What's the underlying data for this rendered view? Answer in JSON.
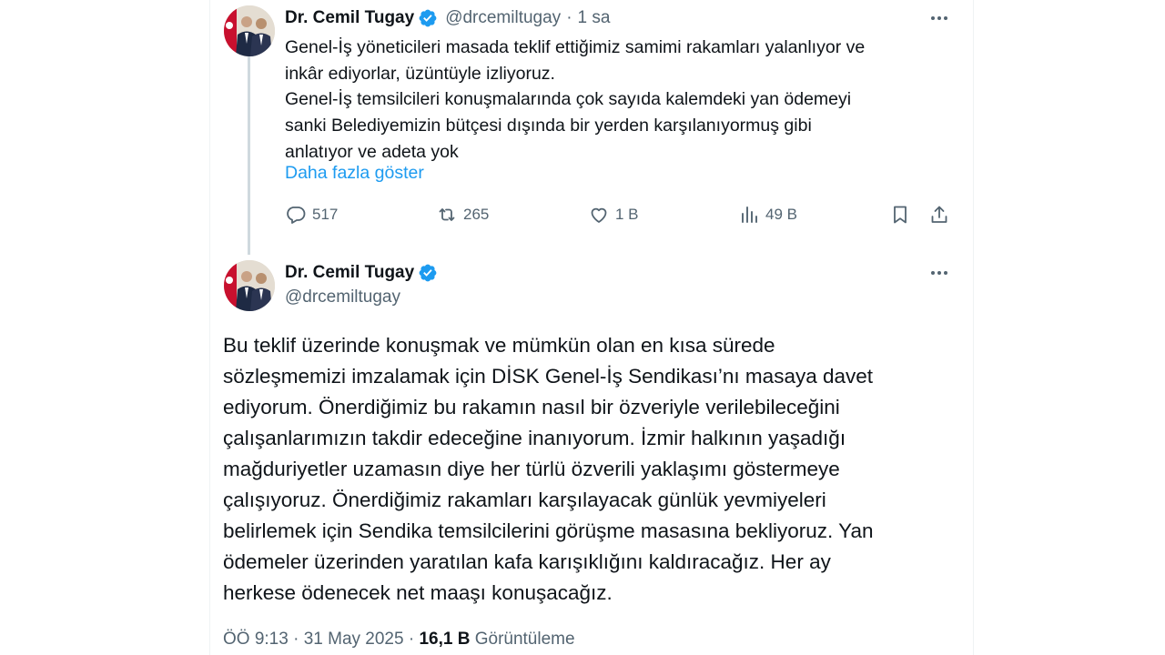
{
  "colors": {
    "accent": "#1d9bf0",
    "text": "#0f1419",
    "muted": "#536471",
    "thread_line": "#cfd9de"
  },
  "reply_tweet": {
    "author_name": "Dr. Cemil Tugay",
    "handle": "@drcemiltugay",
    "separator": "·",
    "time": "1 sa",
    "body_lines": [
      "Genel-İş yöneticileri masada teklif ettiğimiz samimi rakamları yalanlıyor ve",
      "inkâr ediyorlar, üzüntüyle izliyoruz.",
      "Genel-İş temsilcileri konuşmalarında çok sayıda kalemdeki yan ödemeyi",
      "sanki Belediyemizin bütçesi dışında bir yerden karşılanıyormuş gibi",
      "anlatıyor ve adeta yok"
    ],
    "show_more": "Daha fazla göster",
    "replies": "517",
    "reposts": "265",
    "likes": "1 B",
    "views": "49 B",
    "icons": [
      "reply-icon",
      "repost-icon",
      "like-icon",
      "views-icon",
      "bookmark-icon",
      "share-icon"
    ]
  },
  "main_tweet": {
    "author_name": "Dr. Cemil Tugay",
    "handle": "@drcemiltugay",
    "body_lines": [
      "Bu teklif üzerinde konuşmak ve mümkün olan en kısa sürede",
      "sözleşmemizi imzalamak için DİSK Genel-İş Sendikası’nı masaya davet",
      "ediyorum. Önerdiğimiz bu rakamın nasıl bir özveriyle verilebileceğini",
      "çalışanlarımızın takdir edeceğine inanıyorum. İzmir halkının yaşadığı",
      "mağduriyetler uzamasın diye her türlü özverili yaklaşımı göstermeye",
      "çalışıyoruz. Önerdiğimiz rakamları karşılayacak günlük yevmiyeleri",
      "belirlemek için Sendika temsilcilerini görüşme masasına bekliyoruz. Yan",
      "ödemeler üzerinden yaratılan kafa karışıklığını kaldıracağız. Her ay",
      "herkese ödenecek net maaşı konuşacağız."
    ],
    "timestamp": "ÖÖ 9:13 · 31 May 2025 ·",
    "view_count": "16,1 B",
    "view_label": "Görüntüleme"
  }
}
